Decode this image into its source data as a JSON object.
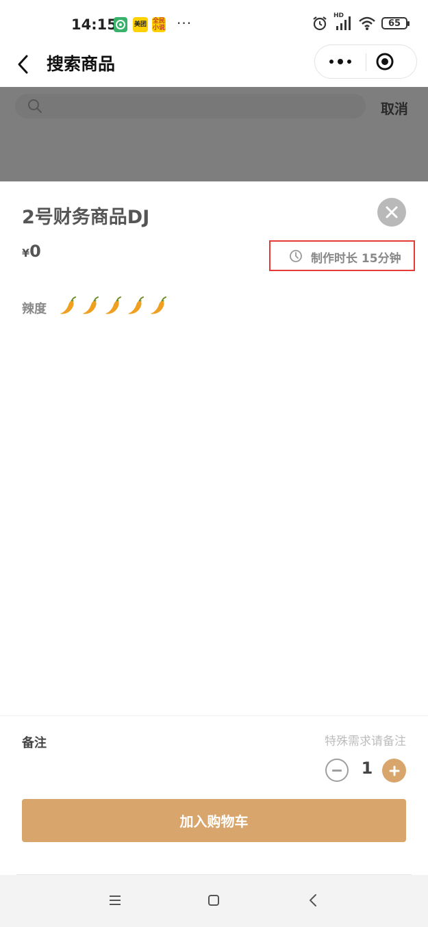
{
  "status_bar": {
    "time": "14:15",
    "app_icons": [
      {
        "name": "green-app-icon",
        "label": ""
      },
      {
        "name": "meituan-icon",
        "label": "美团"
      },
      {
        "name": "mini-novel-icon",
        "label": "全民小说"
      }
    ],
    "overflow": "···",
    "network": "HD",
    "battery": "65"
  },
  "nav": {
    "title": "搜索商品"
  },
  "search": {
    "placeholder": "",
    "cancel_label": "取消"
  },
  "product": {
    "name": "2号财务商品DJ",
    "currency": "¥",
    "price": "0",
    "prep_time_label": "制作时长 15分钟",
    "spicy_label": "辣度",
    "spicy_level": 5,
    "pepper_color": "#f0a020"
  },
  "order": {
    "remark_label": "备注",
    "remark_placeholder": "特殊需求请备注",
    "quantity": "1",
    "add_to_cart_label": "加入购物车",
    "accent_color": "#d8a66d"
  },
  "highlight_color": "#e53935"
}
